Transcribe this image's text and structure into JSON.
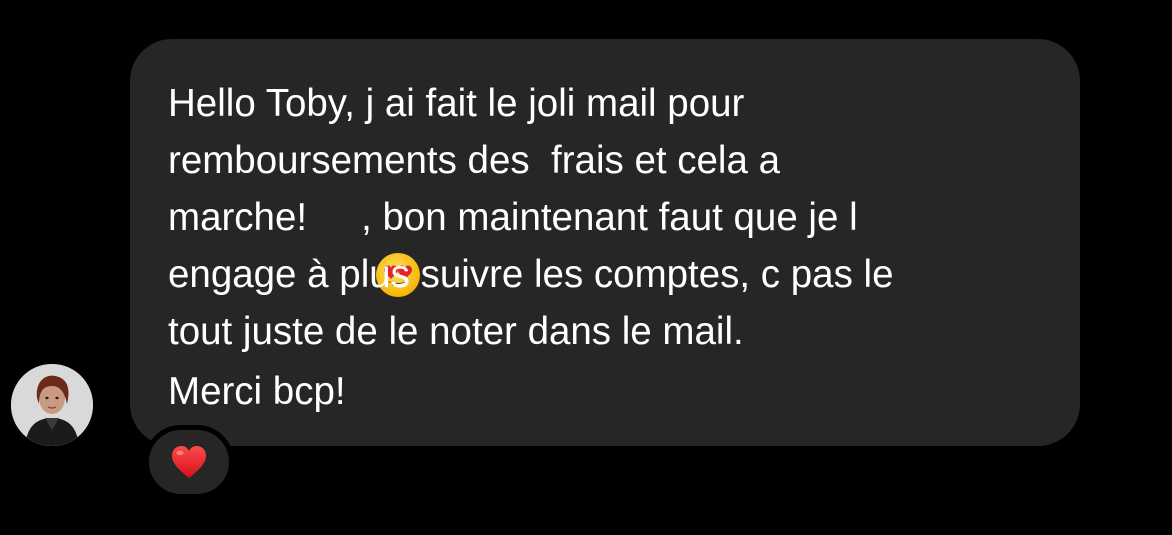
{
  "message": {
    "lines": [
      "Hello Toby, j ai fait le joli mail pour",
      "remboursements des  frais et cela a",
      "marche!",
      ", bon maintenant faut que je l",
      "engage à plus suivre les comptes, c pas le",
      "tout juste de le noter dans le mail.",
      "Merci bcp!"
    ],
    "inline_emoji": "heart-eyes-emoji"
  },
  "reaction": {
    "emoji": "red-heart-icon"
  },
  "avatar": {
    "icon": "user-avatar"
  },
  "colors": {
    "background": "#000000",
    "bubble": "#262626",
    "text": "#ffffff",
    "heart": "#e8202a",
    "emoji_face": "#ffcc33"
  }
}
